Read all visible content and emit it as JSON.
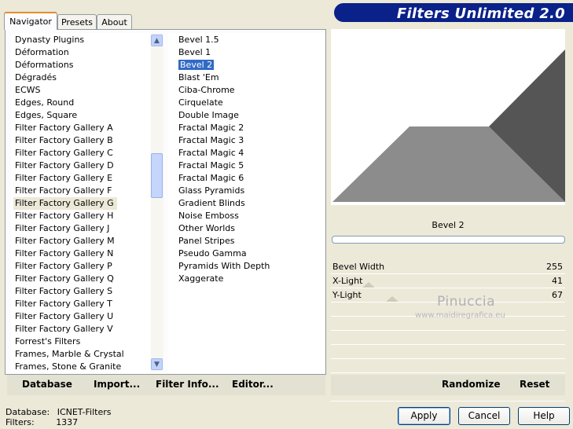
{
  "app": {
    "title": "Filters Unlimited 2.0"
  },
  "tabs": [
    {
      "label": "Navigator",
      "active": true
    },
    {
      "label": "Presets",
      "active": false
    },
    {
      "label": "About",
      "active": false
    }
  ],
  "categories": {
    "items": [
      "Dynasty Plugins",
      "Déformation",
      "Déformations",
      "Dégradés",
      "ECWS",
      "Edges, Round",
      "Edges, Square",
      "Filter Factory Gallery A",
      "Filter Factory Gallery B",
      "Filter Factory Gallery C",
      "Filter Factory Gallery D",
      "Filter Factory Gallery E",
      "Filter Factory Gallery F",
      "Filter Factory Gallery G",
      "Filter Factory Gallery H",
      "Filter Factory Gallery J",
      "Filter Factory Gallery M",
      "Filter Factory Gallery N",
      "Filter Factory Gallery P",
      "Filter Factory Gallery Q",
      "Filter Factory Gallery S",
      "Filter Factory Gallery T",
      "Filter Factory Gallery U",
      "Filter Factory Gallery V",
      "Forrest's Filters",
      "Frames, Marble & Crystal",
      "Frames, Stone & Granite"
    ],
    "selected": "Filter Factory Gallery G"
  },
  "filters": {
    "items": [
      "Bevel 1.5",
      "Bevel 1",
      "Bevel 2",
      "Blast 'Em",
      "Ciba-Chrome",
      "Cirquelate",
      "Double Image",
      "Fractal Magic 2",
      "Fractal Magic 3",
      "Fractal Magic 4",
      "Fractal Magic 5",
      "Fractal Magic 6",
      "Glass Pyramids",
      "Gradient Blinds",
      "Noise Emboss",
      "Other Worlds",
      "Panel Stripes",
      "Pseudo Gamma",
      "Pyramids With Depth",
      "Xaggerate"
    ],
    "selected": "Bevel 2"
  },
  "preview": {
    "filter_name": "Bevel 2",
    "progress": 0
  },
  "params": [
    {
      "label": "Bevel Width",
      "value": "255"
    },
    {
      "label": "X-Light",
      "value": "41"
    },
    {
      "label": "Y-Light",
      "value": "67"
    }
  ],
  "watermark": {
    "line1": "Pinuccia",
    "line2": "www.maidiregrafica.eu"
  },
  "toolbar": {
    "database": "Database",
    "import": "Import...",
    "filter_info": "Filter Info...",
    "editor": "Editor...",
    "randomize": "Randomize",
    "reset": "Reset"
  },
  "status": {
    "database_label": "Database:",
    "database_value": "ICNET-Filters",
    "filters_label": "Filters:",
    "filters_value": "1337"
  },
  "buttons": {
    "apply": "Apply",
    "cancel": "Cancel",
    "help": "Help"
  },
  "colors": {
    "title_bar": "#0a2189",
    "selection": "#316ac5",
    "tab_highlight": "#e68b2c"
  }
}
